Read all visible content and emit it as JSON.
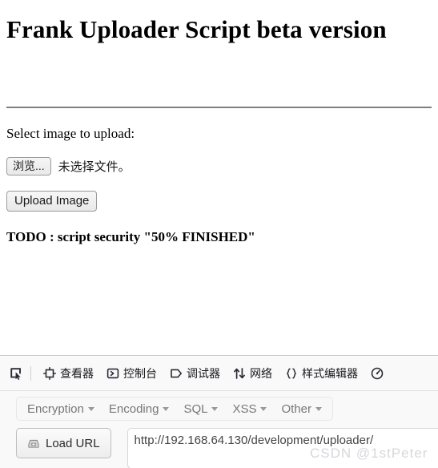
{
  "page": {
    "title": "Frank Uploader Script beta version",
    "select_label": "Select image to upload:",
    "browse_button": "浏览...",
    "file_status": "未选择文件。",
    "upload_button": "Upload Image",
    "todo_text": "TODO : script security \"50% FINISHED\""
  },
  "devtools": {
    "picker_icon": "element-picker-icon",
    "tabs": [
      {
        "label": "查看器",
        "icon": "inspector-target-icon"
      },
      {
        "label": "控制台",
        "icon": "console-chevron-icon"
      },
      {
        "label": "调试器",
        "icon": "debugger-tag-icon"
      },
      {
        "label": "网络",
        "icon": "network-arrows-icon"
      },
      {
        "label": "样式编辑器",
        "icon": "style-editor-braces-icon"
      },
      {
        "label": "",
        "icon": "performance-gauge-icon"
      }
    ]
  },
  "hackbar": {
    "menus": [
      {
        "label": "Encryption"
      },
      {
        "label": "Encoding"
      },
      {
        "label": "SQL"
      },
      {
        "label": "XSS"
      },
      {
        "label": "Other"
      }
    ],
    "load_url_button": "Load URL",
    "load_url_icon": "load-url-icon",
    "url_value": "http://192.168.64.130/development/uploader/"
  },
  "watermark": "CSDN @1stPeter"
}
